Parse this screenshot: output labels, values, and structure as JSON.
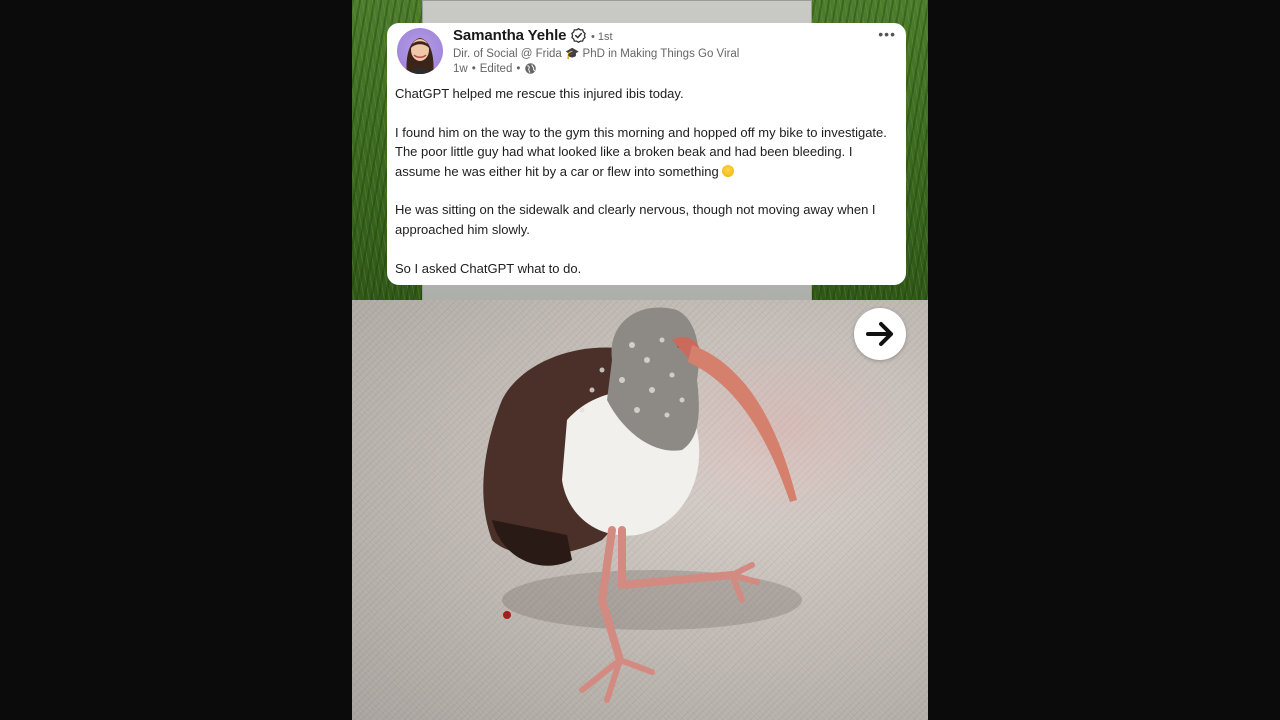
{
  "post": {
    "author_name": "Samantha Yehle",
    "connection_degree": "• 1st",
    "headline": "Dir. of Social @ Frida 🎓 PhD in Making Things Go Viral",
    "timestamp": "1w",
    "separator": "•",
    "edited_label": "Edited",
    "visibility_icon": "globe-icon",
    "more_icon": "more-options-icon",
    "body": [
      "ChatGPT helped me rescue this injured ibis today.",
      "I found him on the way to the gym this morning and hopped off my bike to investigate. The poor little guy had what looked like a broken beak and had been bleeding. I assume he was either hit by a car or flew into something",
      "He was sitting on the sidewalk and clearly nervous, though not moving away when I approached him slowly.",
      "So I asked ChatGPT what to do."
    ],
    "sad_emoji_icon": "sad-face-emoji-icon"
  },
  "image": {
    "subject": "injured ibis on sidewalk photo"
  },
  "navigation": {
    "next_icon": "arrow-right-icon"
  },
  "colors": {
    "card_background": "#ffffff",
    "text_primary": "#1d1d1d",
    "text_secondary": "#666666",
    "page_background": "#0b0b0b"
  }
}
